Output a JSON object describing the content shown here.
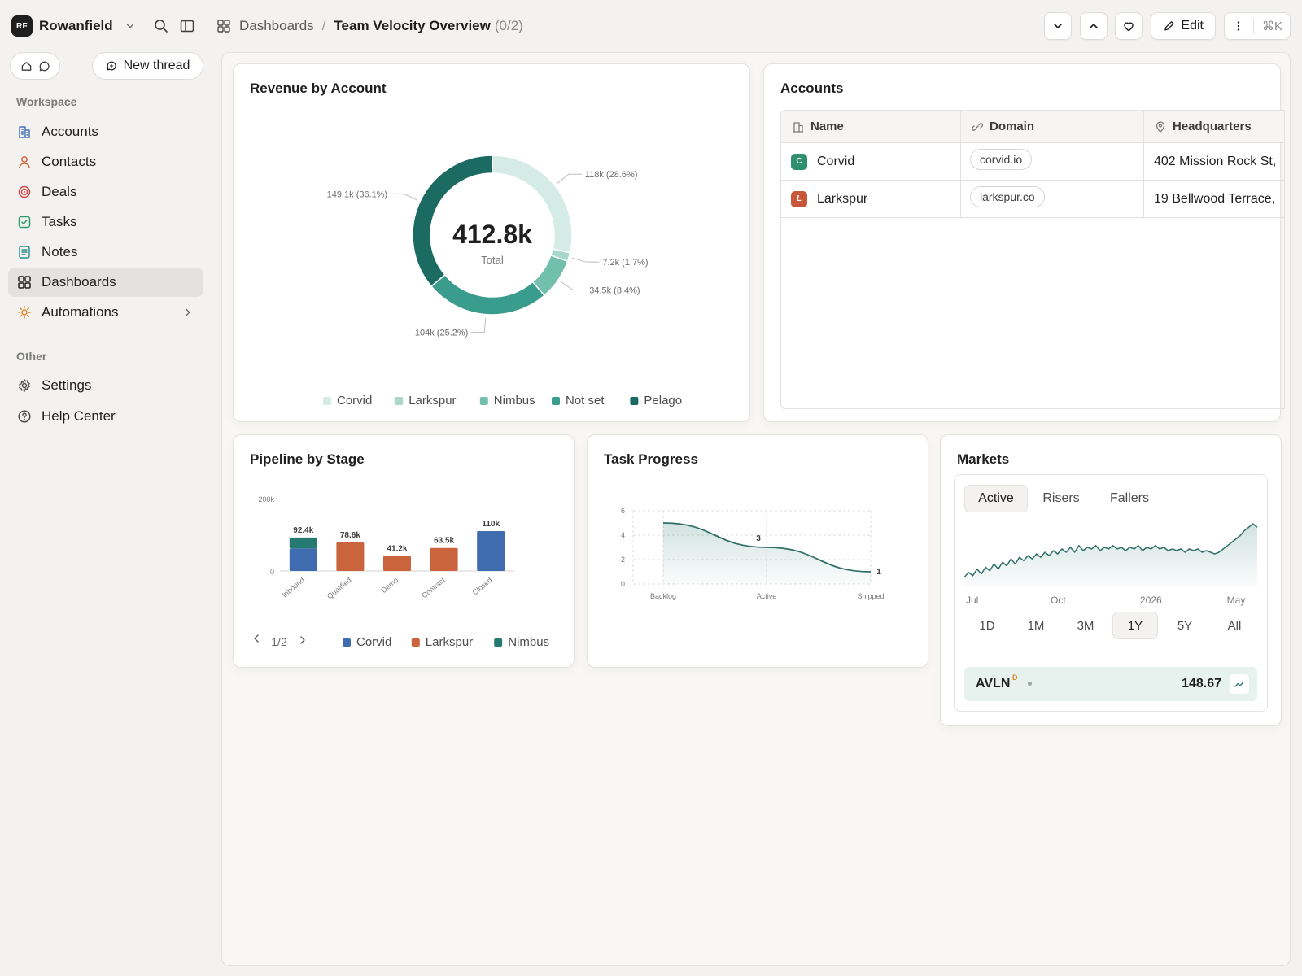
{
  "org": {
    "logo": "RF",
    "name": "Rowanfield"
  },
  "breadcrumb": {
    "root": "Dashboards",
    "separator": "/",
    "current": "Team Velocity Overview",
    "count": "(0/2)"
  },
  "toolbar": {
    "edit_label": "Edit",
    "shortcut": "⌘K"
  },
  "sidebar": {
    "new_thread_label": "New thread",
    "workspace_label": "Workspace",
    "other_label": "Other",
    "items": [
      {
        "label": "Accounts",
        "icon": "building-icon",
        "color": "#4a73b8"
      },
      {
        "label": "Contacts",
        "icon": "person-icon",
        "color": "#d4663f"
      },
      {
        "label": "Deals",
        "icon": "target-icon",
        "color": "#d04848"
      },
      {
        "label": "Tasks",
        "icon": "checkbox-icon",
        "color": "#2f9a6a"
      },
      {
        "label": "Notes",
        "icon": "note-icon",
        "color": "#2f8f8a"
      },
      {
        "label": "Dashboards",
        "icon": "grid-icon",
        "color": "#1f1f1f"
      },
      {
        "label": "Automations",
        "icon": "sun-icon",
        "color": "#d98a2b"
      }
    ],
    "other_items": [
      {
        "label": "Settings",
        "icon": "gear-icon"
      },
      {
        "label": "Help Center",
        "icon": "help-icon"
      }
    ]
  },
  "revenue": {
    "title": "Revenue by Account",
    "center_value": "412.8k",
    "center_label": "Total",
    "chart_data": {
      "type": "pie",
      "title": "Revenue by Account",
      "slices": [
        {
          "name": "Corvid",
          "value": 118000,
          "label": "118k (28.6%)",
          "color": "#d5ebe5"
        },
        {
          "name": "Larkspur",
          "value": 7200,
          "label": "7.2k (1.7%)",
          "color": "#a8d8cb"
        },
        {
          "name": "Nimbus",
          "value": 34500,
          "label": "34.5k (8.4%)",
          "color": "#72bfae"
        },
        {
          "name": "Not set",
          "value": 104000,
          "label": "104k (25.2%)",
          "color": "#3a9c8c"
        },
        {
          "name": "Pelago",
          "value": 149100,
          "label": "149.1k (36.1%)",
          "color": "#1c6b62"
        }
      ],
      "legend_position": "bottom"
    }
  },
  "accounts": {
    "title": "Accounts",
    "columns": [
      "Name",
      "Domain",
      "Headquarters"
    ],
    "rows": [
      {
        "badge": "C",
        "badge_color": "#2f8f6f",
        "name": "Corvid",
        "domain": "corvid.io",
        "hq": "402 Mission Rock St,"
      },
      {
        "badge": "L",
        "badge_color": "#c8573a",
        "name": "Larkspur",
        "domain": "larkspur.co",
        "hq": "19 Bellwood Terrace,"
      }
    ]
  },
  "pipeline": {
    "title": "Pipeline by Stage",
    "pager": "1/2",
    "chart_data": {
      "type": "bar",
      "stacked": true,
      "categories": [
        "Inbound",
        "Qualified",
        "Demo",
        "Contract",
        "Closed"
      ],
      "series": [
        {
          "name": "Corvid",
          "color": "#3f6cae",
          "values": [
            62400,
            0,
            0,
            0,
            110000
          ]
        },
        {
          "name": "Larkspur",
          "color": "#c9643c",
          "values": [
            0,
            78600,
            41200,
            63500,
            0
          ]
        },
        {
          "name": "Nimbus",
          "color": "#267a72",
          "values": [
            30000,
            0,
            0,
            0,
            0
          ]
        }
      ],
      "totals_labels": [
        "92.4k",
        "78.6k",
        "41.2k",
        "63.5k",
        "110k"
      ],
      "yticks": [
        "200k",
        "0"
      ],
      "ylim": [
        0,
        200000
      ]
    }
  },
  "tasks": {
    "title": "Task Progress",
    "chart_data": {
      "type": "area",
      "categories": [
        "Backlog",
        "Active",
        "Shipped"
      ],
      "values": [
        5,
        3,
        1
      ],
      "point_labels": [
        "",
        "3",
        "1"
      ],
      "yticks": [
        0,
        2,
        4,
        6
      ],
      "ylim": [
        0,
        6
      ],
      "grid": true
    }
  },
  "markets": {
    "title": "Markets",
    "tabs": [
      "Active",
      "Risers",
      "Fallers"
    ],
    "active_tab": "Active",
    "ranges": [
      "1D",
      "1M",
      "3M",
      "1Y",
      "5Y",
      "All"
    ],
    "active_range": "1Y",
    "ticker": {
      "symbol": "AVLN",
      "superscript": "D",
      "price": "148.67"
    },
    "chart_data": {
      "type": "area",
      "x_ticks": [
        "Jul",
        "Oct",
        "2026",
        "May"
      ],
      "values": [
        128,
        131,
        129,
        133,
        130,
        134,
        132,
        136,
        133,
        137,
        135,
        139,
        136,
        140,
        138,
        141,
        139,
        142,
        140,
        143,
        141,
        144,
        142,
        145,
        143,
        146,
        143,
        147,
        144,
        146,
        145,
        147,
        144,
        146,
        145,
        147,
        145,
        146,
        144,
        146,
        145,
        147,
        144,
        146,
        145,
        147,
        145,
        146,
        144,
        145,
        144,
        145,
        143,
        145,
        144,
        145,
        143,
        144,
        143,
        142,
        143,
        145,
        147,
        149,
        151,
        153,
        156,
        158,
        160,
        158
      ]
    }
  }
}
